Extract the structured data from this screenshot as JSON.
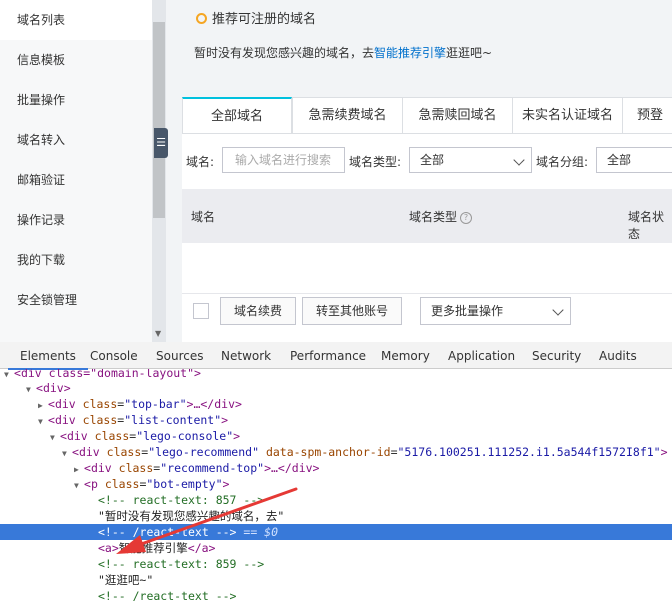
{
  "sidebar": {
    "items": [
      {
        "label": "域名列表",
        "active": true
      },
      {
        "label": "信息模板"
      },
      {
        "label": "批量操作"
      },
      {
        "label": "域名转入"
      },
      {
        "label": "邮箱验证"
      },
      {
        "label": "操作记录"
      },
      {
        "label": "我的下载"
      },
      {
        "label": "安全锁管理"
      }
    ],
    "collapse_icon": "list-collapse-icon"
  },
  "recommend": {
    "title": "推荐可注册的域名",
    "body_before": "暂时没有发现您感兴趣的域名，去",
    "link": "智能推荐引擎",
    "body_after": "逛逛吧~"
  },
  "tabs": [
    "全部域名",
    "急需续费域名",
    "急需赎回域名",
    "未实名认证域名",
    "预登"
  ],
  "filters": {
    "domain_label": "域名:",
    "domain_placeholder": "输入域名进行搜索",
    "type_label": "域名类型:",
    "type_value": "全部",
    "group_label": "域名分组:",
    "group_value": "全部"
  },
  "table": {
    "columns": [
      "域名",
      "域名类型",
      "域名状态"
    ]
  },
  "bulk": {
    "renew_button": "域名续费",
    "transfer_button": "转至其他账号",
    "more_select": "更多批量操作"
  },
  "devtools": {
    "tabs": [
      "Elements",
      "Console",
      "Sources",
      "Network",
      "Performance",
      "Memory",
      "Application",
      "Security",
      "Audits"
    ],
    "active_tab": "Elements",
    "lines": {
      "l0": "div class=\"domain-layout\"",
      "l1": "div",
      "l2_tag": "div",
      "l2_attr": "class",
      "l2_val": "\"top-bar\"",
      "l3_tag": "div",
      "l3_attr": "class",
      "l3_val": "\"list-content\"",
      "l4_tag": "div",
      "l4_attr": "class",
      "l4_val": "\"lego-console\"",
      "l5_tag": "div",
      "l5_attr": "class",
      "l5_val": "\"lego-recommend\"",
      "l5_attr2": "data-spm-anchor-id",
      "l5_val2": "\"5176.100251.111252.i1.5a544f1572I8f1\"",
      "l6_tag": "div",
      "l6_attr": "class",
      "l6_val": "\"recommend-top\"",
      "l7_tag": "p",
      "l7_attr": "class",
      "l7_val": "\"bot-empty\"",
      "l8": "<!-- react-text: 857 -->",
      "l9": "\"暂时没有发现您感兴趣的域名，去\"",
      "l10": "<!-- /react-text -->",
      "l10_suffix": " == $0",
      "l11_text": "智能推荐引擎",
      "l12": "<!-- react-text: 859 -->",
      "l13": "\"逛逛吧~\"",
      "l14": "<!-- /react-text -->"
    }
  },
  "colors": {
    "accent": "#00c1de",
    "link": "#0070cc",
    "selection": "#3879d9",
    "annotation_arrow": "#e53935"
  }
}
